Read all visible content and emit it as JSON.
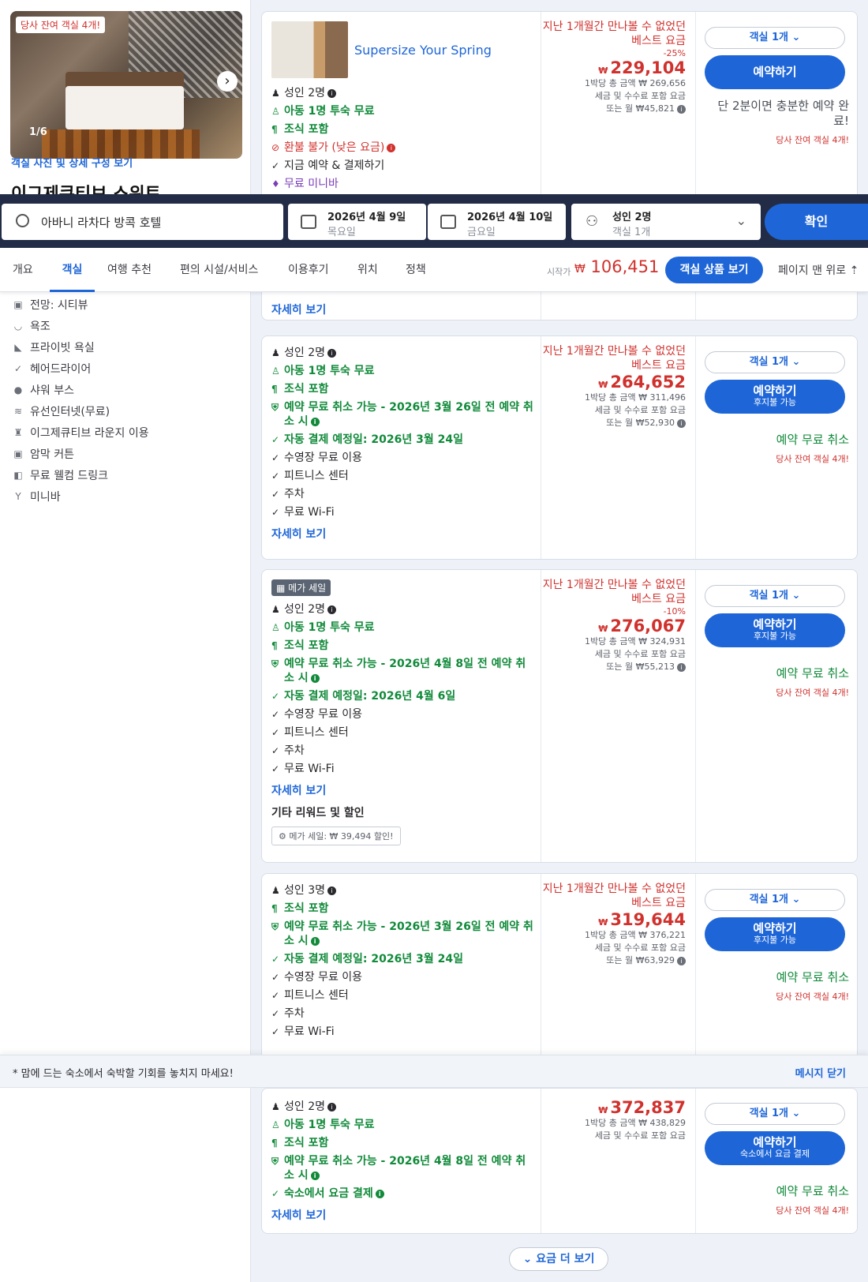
{
  "room": {
    "remaining_badge": "당사 잔여 객실 4개!",
    "photo_count": "1/6",
    "photo_link": "객실 사진 및 상세 구성 보기",
    "title": "이그제큐티브 스위트",
    "amenities": [
      {
        "icon": "view-icon",
        "glyph": "▣",
        "label": "전망: 시티뷰"
      },
      {
        "icon": "bathtub-icon",
        "glyph": "◡",
        "label": "욕조"
      },
      {
        "icon": "bathroom-icon",
        "glyph": "◣",
        "label": "프라이빗 욕실"
      },
      {
        "icon": "check-icon",
        "glyph": "✓",
        "label": "헤어드라이어"
      },
      {
        "icon": "shower-icon",
        "glyph": "●",
        "label": "샤워 부스"
      },
      {
        "icon": "wifi-icon",
        "glyph": "≋",
        "label": "유선인터넷(무료)"
      },
      {
        "icon": "lounge-icon",
        "glyph": "♜",
        "label": "이그제큐티브 라운지 이용"
      },
      {
        "icon": "curtain-icon",
        "glyph": "▣",
        "label": "암막 커튼"
      },
      {
        "icon": "drink-icon",
        "glyph": "◧",
        "label": "무료 웰컴 드링크"
      },
      {
        "icon": "minibar-icon",
        "glyph": "Y",
        "label": "미니바"
      }
    ]
  },
  "search": {
    "query": "아바니 라차다 방콕 호텔",
    "checkin_date": "2026년 4월 9일",
    "checkin_day": "목요일",
    "checkout_date": "2026년 4월 10일",
    "checkout_day": "금요일",
    "guests": "성인 2명",
    "rooms": "객실 1개",
    "confirm": "확인"
  },
  "tabs": [
    "개요",
    "객실",
    "여행 추천",
    "편의 시설/서비스",
    "이용후기",
    "위치",
    "정책"
  ],
  "tabbar": {
    "from_label": "시작가",
    "currency": "₩",
    "from_price": "106,451",
    "view_button": "객실 상품 보기",
    "top_link": "페이지 맨 위로"
  },
  "offers": [
    {
      "promo": "Supersize Your Spring",
      "features": [
        {
          "text": "성인 2명",
          "style": "",
          "glyph": "♟"
        },
        {
          "text": "아동 1명 투숙 무료",
          "style": "green",
          "glyph": "♙"
        },
        {
          "text": "조식 포함",
          "style": "green",
          "glyph": "¶"
        },
        {
          "text": "환불 불가 (낮은 요금)",
          "style": "red",
          "glyph": "⊘"
        },
        {
          "text": "지금 예약 & 결제하기",
          "style": "",
          "glyph": "✓"
        },
        {
          "text": "무료 미니바",
          "style": "purple",
          "glyph": "♦"
        }
      ],
      "best": "지난 1개월간 만나볼 수 없었던 베스트 요금",
      "discount": "-25%",
      "price": "229,104",
      "total": "1박당 총 금액 ₩ 269,656",
      "tax": "세금 및 수수료 포함 요금",
      "monthly": "또는 월 ₩45,821",
      "rooms": "객실 1개",
      "book": "예약하기",
      "book_sub": "",
      "note": "단 2분이면 충분한 예약 완료!",
      "left": "당사 잔여 객실 4개!"
    },
    {
      "features": [
        {
          "text": "성인 2명",
          "style": "",
          "glyph": "♟"
        },
        {
          "text": "아동 1명 투숙 무료",
          "style": "green",
          "glyph": "♙"
        },
        {
          "text": "조식 포함",
          "style": "green",
          "glyph": "¶"
        },
        {
          "text": "예약 무료 취소 가능 - 2026년 3월 26일 전 예약 취소 시",
          "style": "green",
          "glyph": "⛨"
        },
        {
          "text": "자동 결제 예정일: 2026년 3월 24일",
          "style": "green",
          "glyph": "✓"
        },
        {
          "text": "수영장 무료 이용",
          "style": "",
          "glyph": "✓"
        },
        {
          "text": "피트니스 센터",
          "style": "",
          "glyph": "✓"
        },
        {
          "text": "주차",
          "style": "",
          "glyph": "✓"
        },
        {
          "text": "무료 Wi-Fi",
          "style": "",
          "glyph": "✓"
        }
      ],
      "more": "자세히 보기",
      "best": "지난 1개월간 만나볼 수 없었던 베스트 요금",
      "price": "264,652",
      "total": "1박당 총 금액 ₩ 311,496",
      "tax": "세금 및 수수료 포함 요금",
      "monthly": "또는 월 ₩52,930",
      "rooms": "객실 1개",
      "book": "예약하기",
      "book_sub": "후지불 가능",
      "cancel": "예약 무료 취소",
      "left": "당사 잔여 객실 4개!"
    },
    {
      "mega": "메가 세일",
      "features": [
        {
          "text": "성인 2명",
          "style": "",
          "glyph": "♟"
        },
        {
          "text": "아동 1명 투숙 무료",
          "style": "green",
          "glyph": "♙"
        },
        {
          "text": "조식 포함",
          "style": "green",
          "glyph": "¶"
        },
        {
          "text": "예약 무료 취소 가능 - 2026년 4월 8일 전 예약 취소 시",
          "style": "green",
          "glyph": "⛨"
        },
        {
          "text": "자동 결제 예정일: 2026년 4월 6일",
          "style": "green",
          "glyph": "✓"
        },
        {
          "text": "수영장 무료 이용",
          "style": "",
          "glyph": "✓"
        },
        {
          "text": "피트니스 센터",
          "style": "",
          "glyph": "✓"
        },
        {
          "text": "주차",
          "style": "",
          "glyph": "✓"
        },
        {
          "text": "무료 Wi-Fi",
          "style": "",
          "glyph": "✓"
        }
      ],
      "more": "자세히 보기",
      "rewards_title": "기타 리워드 및 할인",
      "rewards_chip": "메가 세일: ₩ 39,494 할인!",
      "best": "지난 1개월간 만나볼 수 없었던 베스트 요금",
      "discount": "-10%",
      "price": "276,067",
      "total": "1박당 총 금액 ₩ 324,931",
      "tax": "세금 및 수수료 포함 요금",
      "monthly": "또는 월 ₩55,213",
      "rooms": "객실 1개",
      "book": "예약하기",
      "book_sub": "후지불 가능",
      "cancel": "예약 무료 취소",
      "left": "당사 잔여 객실 4개!"
    },
    {
      "features": [
        {
          "text": "성인 3명",
          "style": "",
          "glyph": "♟"
        },
        {
          "text": "조식 포함",
          "style": "green",
          "glyph": "¶"
        },
        {
          "text": "예약 무료 취소 가능 - 2026년 3월 26일 전 예약 취소 시",
          "style": "green",
          "glyph": "⛨"
        },
        {
          "text": "자동 결제 예정일: 2026년 3월 24일",
          "style": "green",
          "glyph": "✓"
        },
        {
          "text": "수영장 무료 이용",
          "style": "",
          "glyph": "✓"
        },
        {
          "text": "피트니스 센터",
          "style": "",
          "glyph": "✓"
        },
        {
          "text": "주차",
          "style": "",
          "glyph": "✓"
        },
        {
          "text": "무료 Wi-Fi",
          "style": "",
          "glyph": "✓"
        }
      ],
      "best": "지난 1개월간 만나볼 수 없었던 베스트 요금",
      "price": "319,644",
      "total": "1박당 총 금액 ₩ 376,221",
      "tax": "세금 및 수수료 포함 요금",
      "monthly": "또는 월 ₩63,929",
      "rooms": "객실 1개",
      "book": "예약하기",
      "book_sub": "후지불 가능",
      "cancel": "예약 무료 취소",
      "left": "당사 잔여 객실 4개!"
    },
    {
      "features": [
        {
          "text": "성인 2명",
          "style": "",
          "glyph": "♟"
        },
        {
          "text": "아동 1명 투숙 무료",
          "style": "green",
          "glyph": "♙"
        },
        {
          "text": "조식 포함",
          "style": "green",
          "glyph": "¶"
        },
        {
          "text": "예약 무료 취소 가능 - 2026년 4월 8일 전 예약 취소 시",
          "style": "green",
          "glyph": "⛨"
        },
        {
          "text": "숙소에서 요금 결제",
          "style": "green",
          "glyph": "✓"
        }
      ],
      "more": "자세히 보기",
      "price": "372,837",
      "total": "1박당 총 금액 ₩ 438,829",
      "tax": "세금 및 수수료 포함 요금",
      "rooms": "객실 1개",
      "book": "예약하기",
      "book_sub": "숙소에서 요금 결제",
      "cancel": "예약 무료 취소",
      "left": "당사 잔여 객실 4개!"
    }
  ],
  "notice": {
    "text": "* 맘에 드는 숙소에서 숙박할 기회를 놓치지 마세요!",
    "close": "메시지 닫기"
  },
  "more_rates": "요금 더 보기",
  "prev_card_more": "자세히 보기"
}
